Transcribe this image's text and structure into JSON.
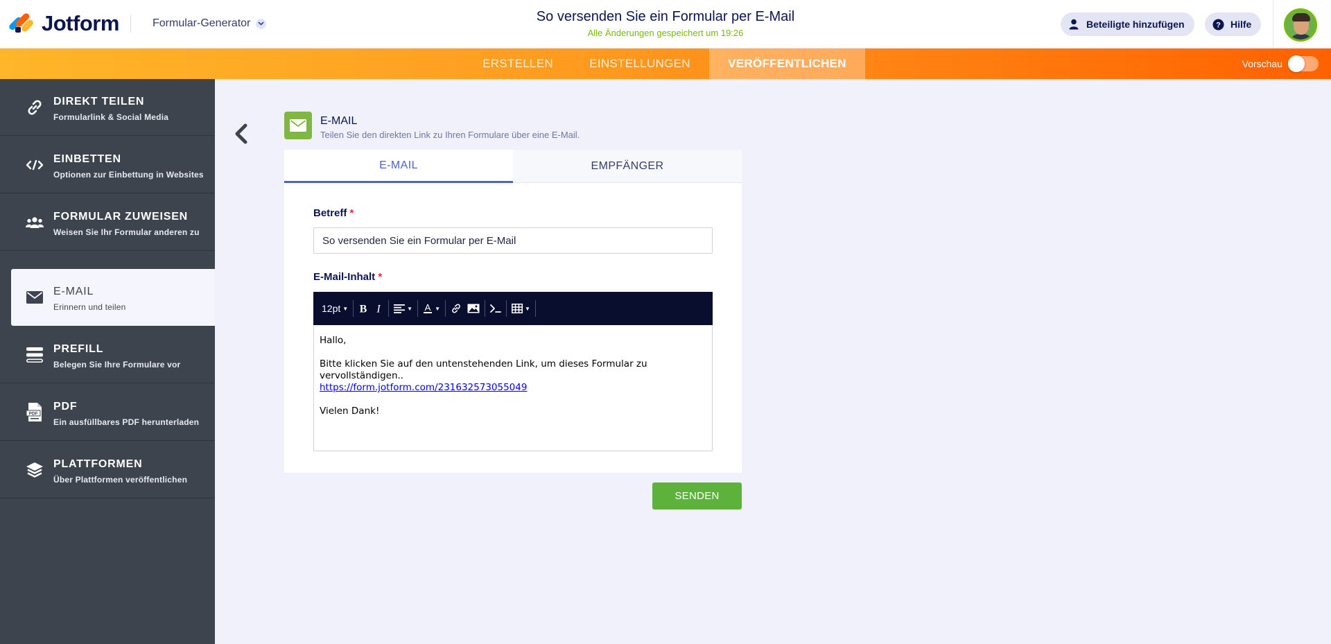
{
  "header": {
    "logo_text": "Jotform",
    "builder_label": "Formular-Generator",
    "form_title": "So versenden Sie ein Formular per E-Mail",
    "saved_status": "Alle Änderungen gespeichert um 19:26",
    "add_participants_label": "Beteiligte hinzufügen",
    "help_label": "Hilfe"
  },
  "nav": {
    "tabs": [
      {
        "label": "ERSTELLEN",
        "active": false
      },
      {
        "label": "EINSTELLUNGEN",
        "active": false
      },
      {
        "label": "VERÖFFENTLICHEN",
        "active": true
      }
    ],
    "preview_label": "Vorschau",
    "preview_on": false
  },
  "sidebar": {
    "items": [
      {
        "title": "DIREKT TEILEN",
        "subtitle": "Formularlink & Social Media",
        "icon": "link-icon"
      },
      {
        "title": "EINBETTEN",
        "subtitle": "Optionen zur Einbettung in Websites",
        "icon": "code-icon"
      },
      {
        "title": "FORMULAR ZUWEISEN",
        "subtitle": "Weisen Sie Ihr Formular anderen zu",
        "icon": "users-icon"
      },
      {
        "title": "E-MAIL",
        "subtitle": "Erinnern und teilen",
        "icon": "envelope-icon",
        "active": true
      },
      {
        "title": "PREFILL",
        "subtitle": "Belegen Sie Ihre Formulare vor",
        "icon": "prefill-icon"
      },
      {
        "title": "PDF",
        "subtitle": "Ein ausfüllbares PDF herunterladen",
        "icon": "pdf-icon"
      },
      {
        "title": "PLATTFORMEN",
        "subtitle": "Über Plattformen veröffentlichen",
        "icon": "layers-icon"
      }
    ]
  },
  "section": {
    "title": "E-MAIL",
    "subtitle": "Teilen Sie den direkten Link zu Ihren Formulare über eine E-Mail."
  },
  "tabs": [
    {
      "label": "E-MAIL",
      "active": true
    },
    {
      "label": "EMPFÄNGER",
      "active": false
    }
  ],
  "form": {
    "subject_label": "Betreff",
    "subject_value": "So versenden Sie ein Formular per E-Mail",
    "body_label": "E-Mail-Inhalt",
    "required_mark": "*",
    "font_size": "12pt",
    "body": {
      "greeting": "Hallo,",
      "instruction": "Bitte klicken Sie auf den untenstehenden Link, um dieses Formular zu vervollständigen..",
      "link": "https://form.jotform.com/231632573055049",
      "closing": "Vielen Dank!"
    }
  },
  "send_label": "SENDEN",
  "colors": {
    "accent_orange": "#ff6100",
    "sidebar_bg": "#3e444e",
    "send_green": "#5cb23a",
    "tab_blue": "#4c63c9",
    "saved_green": "#78bb07"
  }
}
